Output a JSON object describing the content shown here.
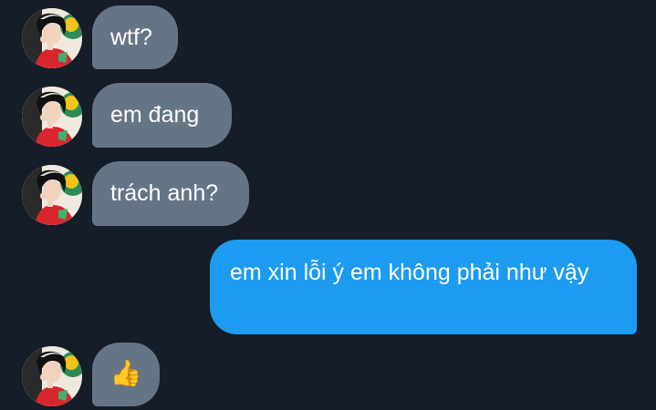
{
  "conversation": {
    "messages": [
      {
        "direction": "incoming",
        "text": "wtf?"
      },
      {
        "direction": "incoming",
        "text": "em đang"
      },
      {
        "direction": "incoming",
        "text": "trách anh?"
      },
      {
        "direction": "outgoing",
        "text": "em xin lỗi ý em không phải như vậy"
      },
      {
        "direction": "incoming",
        "text": "👍"
      }
    ]
  },
  "colors": {
    "background": "#151d28",
    "incoming_bubble": "#667586",
    "outgoing_bubble": "#1d9bf0",
    "text": "#ffffff"
  },
  "icons": {
    "avatar": "contact-avatar",
    "reaction": "thumbs-up-emoji"
  }
}
